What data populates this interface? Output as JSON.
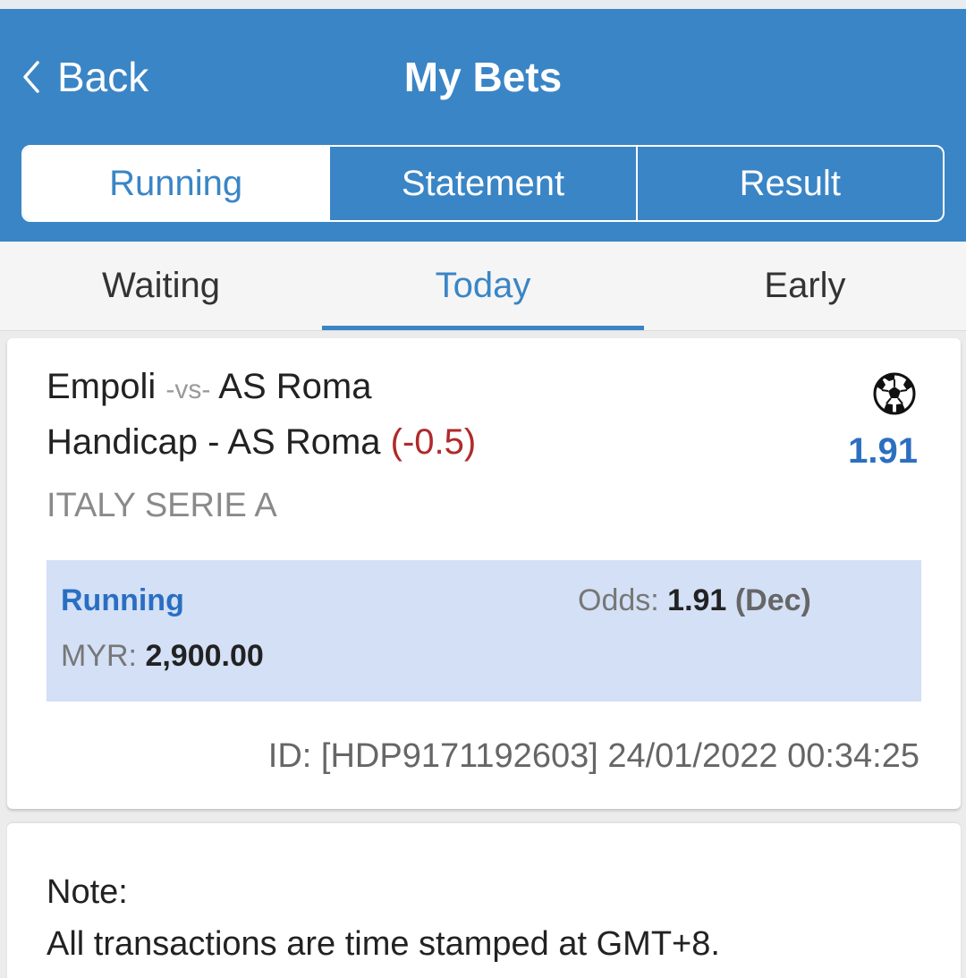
{
  "header": {
    "back_label": "Back",
    "title": "My Bets"
  },
  "main_tabs": [
    {
      "label": "Running",
      "active": true
    },
    {
      "label": "Statement",
      "active": false
    },
    {
      "label": "Result",
      "active": false
    }
  ],
  "sub_tabs": [
    {
      "label": "Waiting",
      "active": false
    },
    {
      "label": "Today",
      "active": true
    },
    {
      "label": "Early",
      "active": false
    }
  ],
  "bet": {
    "home_team": "Empoli",
    "vs_label": "-vs-",
    "away_team": "AS Roma",
    "market": "Handicap - AS Roma",
    "handicap": "(-0.5)",
    "league": "ITALY SERIE A",
    "sport_icon": "soccer-ball-icon",
    "odds": "1.91",
    "status": "Running",
    "odds_label": "Odds:",
    "odds_value": "1.91",
    "odds_format": "(Dec)",
    "currency_label": "MYR:",
    "stake": "2,900.00",
    "id_line": "ID: [HDP9171192603] 24/01/2022 00:34:25"
  },
  "note": {
    "title": "Note:",
    "text": "All transactions are time stamped at GMT+8."
  },
  "colors": {
    "primary": "#3a85c6",
    "status_bg": "#d3e0f6",
    "handicap": "#b02a2a",
    "odds": "#2c6fc0"
  }
}
